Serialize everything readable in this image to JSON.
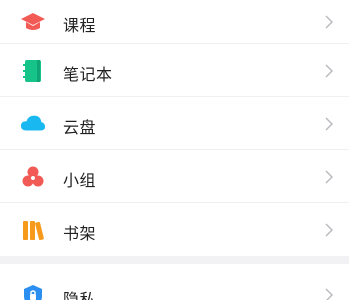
{
  "menu": {
    "items": [
      {
        "label": "课程",
        "icon": "graduation-cap-icon",
        "color": "#f25a55"
      },
      {
        "label": "笔记本",
        "icon": "notebook-icon",
        "color": "#16c48a"
      },
      {
        "label": "云盘",
        "icon": "cloud-icon",
        "color": "#1ab8f0"
      },
      {
        "label": "小组",
        "icon": "group-icon",
        "color": "#f25a55"
      },
      {
        "label": "书架",
        "icon": "bookshelf-icon",
        "color": "#f79a1c"
      }
    ],
    "secondary": [
      {
        "label": "隐私",
        "icon": "privacy-lock-icon",
        "color": "#2a8ff0"
      }
    ]
  },
  "colors": {
    "chevron": "#b8b8be",
    "background": "#f2f2f4"
  }
}
